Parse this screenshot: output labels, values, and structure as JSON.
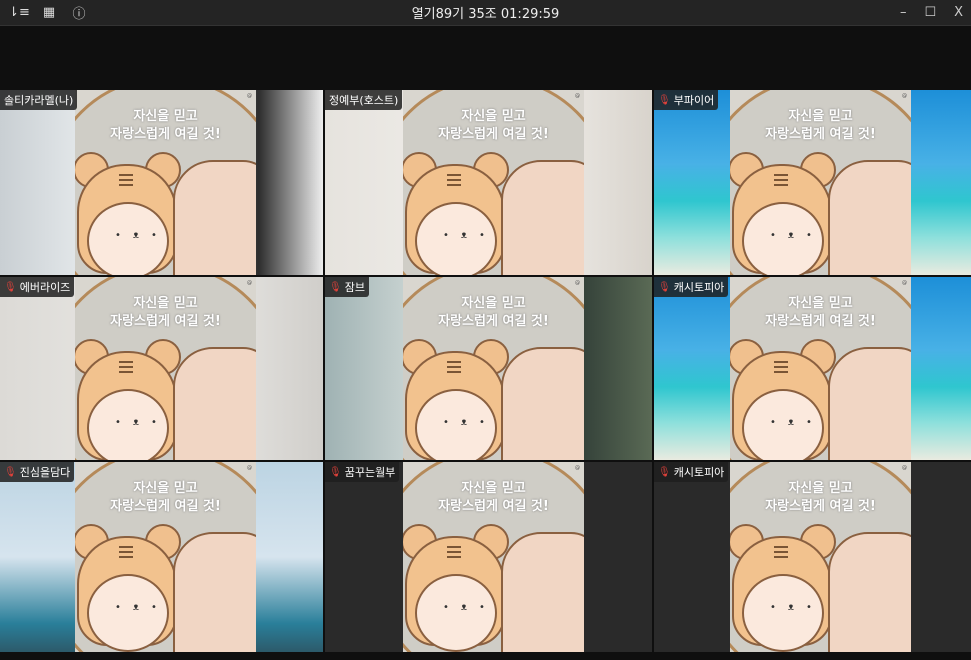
{
  "window": {
    "title": "열기89기 35조 01:29:59"
  },
  "toolbar": {
    "icons": [
      "sort-icon",
      "grid-view-icon",
      "info-icon"
    ],
    "window_controls": {
      "minimize": "–",
      "maximize": "☐",
      "close": "X"
    }
  },
  "artwork": {
    "caption_line1": "자신을 믿고",
    "caption_line2": "자랑스럽게 여길 것!"
  },
  "participants": [
    {
      "name": "솔티카라멜(나)",
      "muted": false,
      "bg": "office"
    },
    {
      "name": "정예부(호스트)",
      "muted": false,
      "bg": "room"
    },
    {
      "name": "부파이어",
      "muted": true,
      "bg": "beach"
    },
    {
      "name": "에버라이즈",
      "muted": true,
      "bg": "wall"
    },
    {
      "name": "잠브",
      "muted": true,
      "bg": "room2"
    },
    {
      "name": "캐시토피아",
      "muted": true,
      "bg": "beach"
    },
    {
      "name": "진심을담다",
      "muted": true,
      "bg": "office2"
    },
    {
      "name": "꿈꾸는월부",
      "muted": true,
      "bg": "dark"
    },
    {
      "name": "캐시토피아",
      "muted": true,
      "bg": "dark"
    }
  ]
}
